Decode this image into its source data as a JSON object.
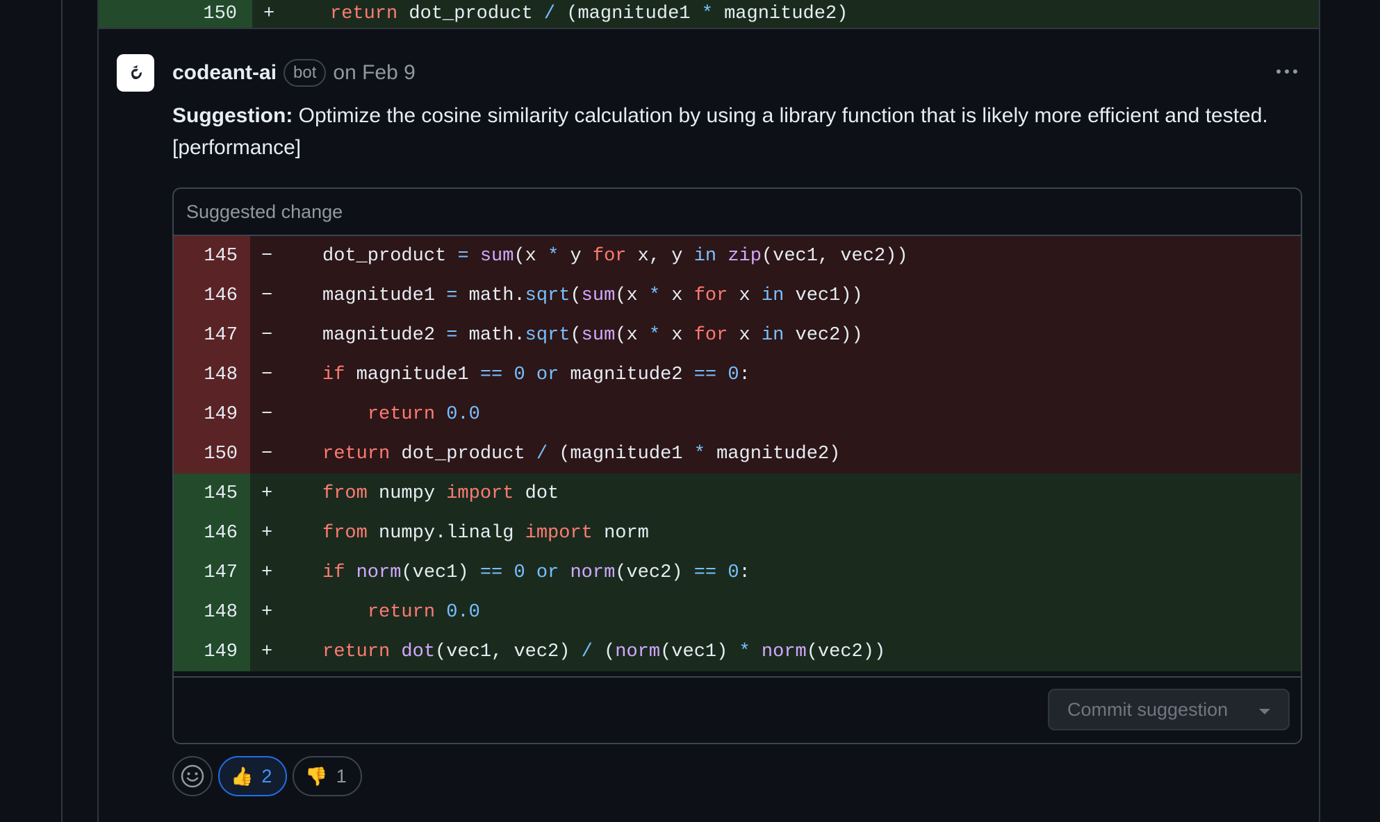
{
  "top_diff": {
    "line_number": "150",
    "marker": "+",
    "code": "return dot_product / (magnitude1 * magnitude2)"
  },
  "comment": {
    "author": "codeant-ai",
    "badge": "bot",
    "date": "on Feb 9",
    "body_label": "Suggestion:",
    "body_text": " Optimize the cosine similarity calculation by using a library function that is likely more efficient and tested. [performance]"
  },
  "suggestion": {
    "title": "Suggested change",
    "removed": [
      {
        "ln": "145",
        "marker": "−"
      },
      {
        "ln": "146",
        "marker": "−"
      },
      {
        "ln": "147",
        "marker": "−"
      },
      {
        "ln": "148",
        "marker": "−"
      },
      {
        "ln": "149",
        "marker": "−"
      },
      {
        "ln": "150",
        "marker": "−"
      }
    ],
    "added": [
      {
        "ln": "145",
        "marker": "+"
      },
      {
        "ln": "146",
        "marker": "+"
      },
      {
        "ln": "147",
        "marker": "+"
      },
      {
        "ln": "148",
        "marker": "+"
      },
      {
        "ln": "149",
        "marker": "+"
      }
    ],
    "commit_label": "Commit suggestion"
  },
  "reactions": {
    "thumbs_up_count": "2",
    "thumbs_down_count": "1"
  },
  "icons": {
    "avatar": "codeant-logo-icon",
    "more": "kebab-horizontal-icon",
    "add_reaction": "smiley-icon",
    "caret": "triangle-down-icon"
  },
  "colors": {
    "deleted_bg": "#2c1618",
    "deleted_gutter": "#5a2326",
    "added_bg": "#1a2b1e",
    "added_gutter": "#224a2b",
    "keyword": "#ff7b72",
    "function": "#d2a8ff",
    "builtin": "#79c0ff"
  }
}
